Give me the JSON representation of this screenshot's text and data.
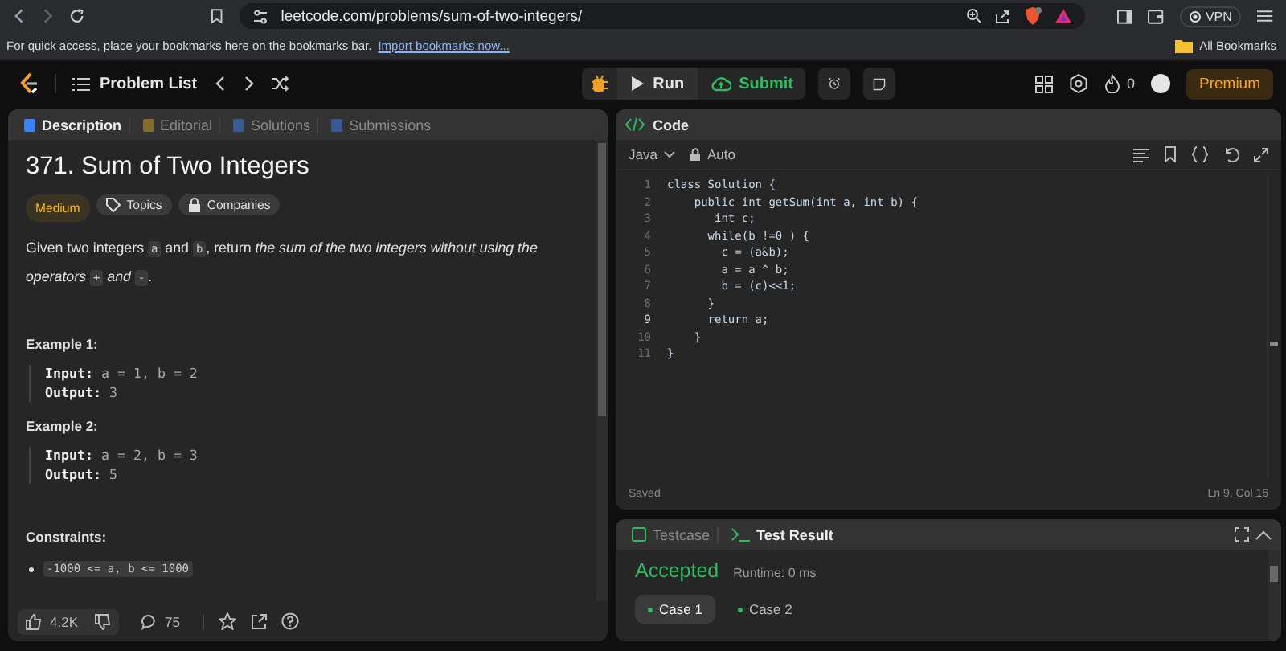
{
  "browser": {
    "url": "leetcode.com/problems/sum-of-two-integers/",
    "vpn": "VPN",
    "bookmarks_message": "For quick access, place your bookmarks here on the bookmarks bar.",
    "import_link": "Import bookmarks now...",
    "all_bookmarks": "All Bookmarks"
  },
  "nav": {
    "problem_list": "Problem List",
    "run": "Run",
    "submit": "Submit",
    "streak": "0",
    "premium": "Premium"
  },
  "left_panel": {
    "tabs": [
      {
        "label": "Description",
        "selected": true
      },
      {
        "label": "Editorial",
        "selected": false
      },
      {
        "label": "Solutions",
        "selected": false
      },
      {
        "label": "Submissions",
        "selected": false
      }
    ],
    "title": "371. Sum of Two Integers",
    "difficulty": "Medium",
    "tags": [
      "Topics",
      "Companies"
    ],
    "description": [
      {
        "kind": "text",
        "text": "Given two integers "
      },
      {
        "kind": "code",
        "text": "a"
      },
      {
        "kind": "text",
        "text": " and "
      },
      {
        "kind": "code",
        "text": "b"
      },
      {
        "kind": "text",
        "text": ", return "
      },
      {
        "kind": "italic",
        "text": "the sum of the two integers without using the operators "
      },
      {
        "kind": "code",
        "text": "+"
      },
      {
        "kind": "italic",
        "text": " and "
      },
      {
        "kind": "code",
        "text": "-"
      },
      {
        "kind": "text",
        "text": "."
      }
    ],
    "examples": [
      {
        "heading": "Example 1:",
        "lines": [
          {
            "label": "Input:",
            "value": "a = 1, b = 2"
          },
          {
            "label": "Output:",
            "value": "3"
          }
        ]
      },
      {
        "heading": "Example 2:",
        "lines": [
          {
            "label": "Input:",
            "value": "a = 2, b = 3"
          },
          {
            "label": "Output:",
            "value": "5"
          }
        ]
      }
    ],
    "constraints_heading": "Constraints:",
    "constraints": [
      "-1000 <= a, b <= 1000"
    ],
    "likes": "4.2K",
    "comments": "75"
  },
  "code_panel": {
    "title": "Code",
    "language": "Java",
    "mode": "Auto",
    "lines": [
      {
        "number": "1",
        "text": "class Solution {",
        "current": false
      },
      {
        "number": "2",
        "text": "    public int getSum(int a, int b) {",
        "current": false
      },
      {
        "number": "3",
        "text": "       int c;",
        "current": false
      },
      {
        "number": "4",
        "text": "      while(b !=0 ) {",
        "current": false
      },
      {
        "number": "5",
        "text": "        c = (a&b);",
        "current": false
      },
      {
        "number": "6",
        "text": "        a = a ^ b;",
        "current": false
      },
      {
        "number": "7",
        "text": "        b = (c)<<1;",
        "current": false
      },
      {
        "number": "8",
        "text": "      }",
        "current": false
      },
      {
        "number": "9",
        "text": "      return a;",
        "current": true
      },
      {
        "number": "10",
        "text": "    }",
        "current": false
      },
      {
        "number": "11",
        "text": "}",
        "current": false
      }
    ],
    "status": "Saved",
    "cursor": "Ln 9, Col 16"
  },
  "result_panel": {
    "tabs": [
      {
        "label": "Testcase",
        "selected": false
      },
      {
        "label": "Test Result",
        "selected": true
      }
    ],
    "verdict": "Accepted",
    "runtime": "Runtime: 0 ms",
    "cases": [
      {
        "label": "Case 1",
        "selected": true
      },
      {
        "label": "Case 2",
        "selected": false
      }
    ]
  }
}
